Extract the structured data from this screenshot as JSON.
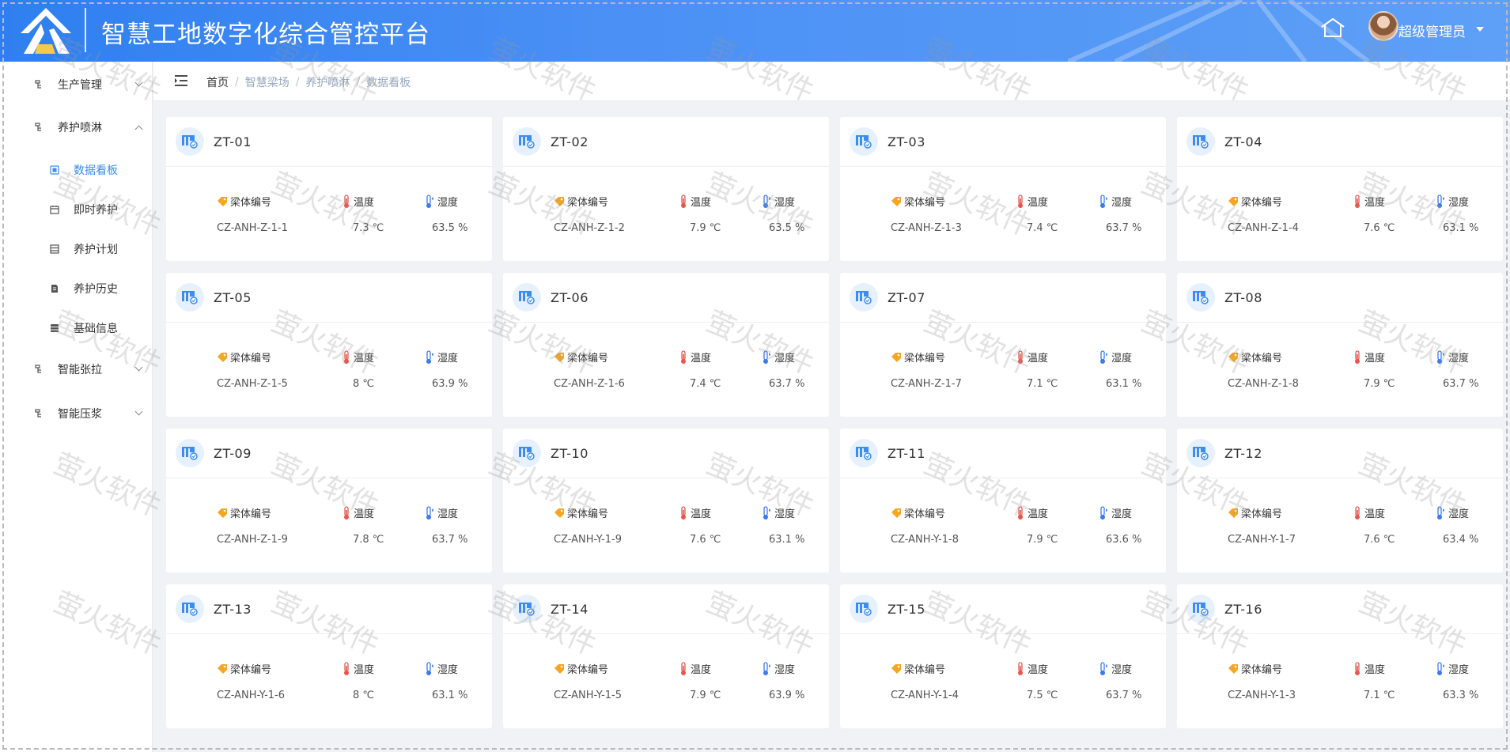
{
  "header": {
    "title": "智慧工地数字化综合管控平台",
    "user_name": "超级管理员"
  },
  "sidebar": {
    "items": [
      {
        "label": "生产管理",
        "level": 1,
        "expanded": false
      },
      {
        "label": "养护喷淋",
        "level": 1,
        "expanded": true
      },
      {
        "label": "数据看板",
        "level": 2,
        "active": true
      },
      {
        "label": "即时养护",
        "level": 2
      },
      {
        "label": "养护计划",
        "level": 2
      },
      {
        "label": "养护历史",
        "level": 2
      },
      {
        "label": "基础信息",
        "level": 2
      },
      {
        "label": "智能张拉",
        "level": 1,
        "expanded": false
      },
      {
        "label": "智能压浆",
        "level": 1,
        "expanded": false
      }
    ]
  },
  "breadcrumb": [
    "首页",
    "智慧梁场",
    "养护喷淋",
    "数据看板"
  ],
  "card_labels": {
    "code": "梁体编号",
    "temp": "温度",
    "humidity": "湿度"
  },
  "cards": [
    {
      "id": "ZT-01",
      "code": "CZ-ANH-Z-1-1",
      "temp": "7.3 ℃",
      "humidity": "63.5 %"
    },
    {
      "id": "ZT-02",
      "code": "CZ-ANH-Z-1-2",
      "temp": "7.9 ℃",
      "humidity": "63.5 %"
    },
    {
      "id": "ZT-03",
      "code": "CZ-ANH-Z-1-3",
      "temp": "7.4 ℃",
      "humidity": "63.7 %"
    },
    {
      "id": "ZT-04",
      "code": "CZ-ANH-Z-1-4",
      "temp": "7.6 ℃",
      "humidity": "63.1 %"
    },
    {
      "id": "ZT-05",
      "code": "CZ-ANH-Z-1-5",
      "temp": "8 ℃",
      "humidity": "63.9 %"
    },
    {
      "id": "ZT-06",
      "code": "CZ-ANH-Z-1-6",
      "temp": "7.4 ℃",
      "humidity": "63.7 %"
    },
    {
      "id": "ZT-07",
      "code": "CZ-ANH-Z-1-7",
      "temp": "7.1 ℃",
      "humidity": "63.1 %"
    },
    {
      "id": "ZT-08",
      "code": "CZ-ANH-Z-1-8",
      "temp": "7.9 ℃",
      "humidity": "63.7 %"
    },
    {
      "id": "ZT-09",
      "code": "CZ-ANH-Z-1-9",
      "temp": "7.8 ℃",
      "humidity": "63.7 %"
    },
    {
      "id": "ZT-10",
      "code": "CZ-ANH-Y-1-9",
      "temp": "7.6 ℃",
      "humidity": "63.1 %"
    },
    {
      "id": "ZT-11",
      "code": "CZ-ANH-Y-1-8",
      "temp": "7.9 ℃",
      "humidity": "63.6 %"
    },
    {
      "id": "ZT-12",
      "code": "CZ-ANH-Y-1-7",
      "temp": "7.6 ℃",
      "humidity": "63.4 %"
    },
    {
      "id": "ZT-13",
      "code": "CZ-ANH-Y-1-6",
      "temp": "8 ℃",
      "humidity": "63.1 %"
    },
    {
      "id": "ZT-14",
      "code": "CZ-ANH-Y-1-5",
      "temp": "7.9 ℃",
      "humidity": "63.9 %"
    },
    {
      "id": "ZT-15",
      "code": "CZ-ANH-Y-1-4",
      "temp": "7.5 ℃",
      "humidity": "63.7 %"
    },
    {
      "id": "ZT-16",
      "code": "CZ-ANH-Y-1-3",
      "temp": "7.1 ℃",
      "humidity": "63.3 %"
    }
  ],
  "watermark": "萤火软件",
  "colors": {
    "header": "#4a90f5",
    "active": "#3b8df4",
    "tag": "#f5a623",
    "temp": "#e8574d",
    "humidity": "#3b7bf0"
  }
}
